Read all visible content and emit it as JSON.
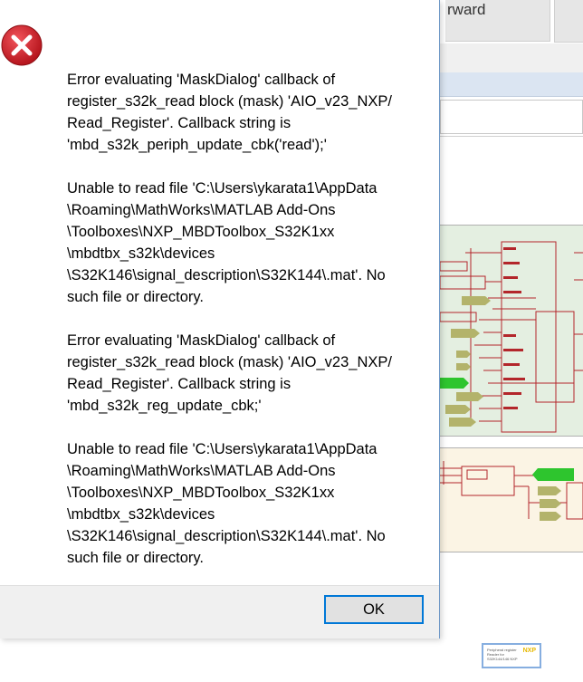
{
  "background_window": {
    "tab_label": "rward",
    "thumbnail_text": "Peripheral register Reader for S32K144/146 NXP"
  },
  "dialog": {
    "icon": "error-icon",
    "messages": {
      "m1": {
        "line1": "Error evaluating 'MaskDialog' callback of",
        "line2": "register_s32k_read block (mask) 'AIO_v23_NXP/",
        "line3": "Read_Register'. Callback string is",
        "line4": "'mbd_s32k_periph_update_cbk('read');'"
      },
      "m2": {
        "line1": "Unable to read file 'C:\\Users\\ykarata1\\AppData",
        "line2": "\\Roaming\\MathWorks\\MATLAB Add-Ons",
        "line3": "\\Toolboxes\\NXP_MBDToolbox_S32K1xx",
        "line4": "\\mbdtbx_s32k\\devices",
        "line5": "\\S32K146\\signal_description\\S32K144\\.mat'. No",
        "line6": "such file or directory."
      },
      "m3": {
        "line1": "Error evaluating 'MaskDialog' callback of",
        "line2": "register_s32k_read block (mask) 'AIO_v23_NXP/",
        "line3": "Read_Register'. Callback string is",
        "line4": "'mbd_s32k_reg_update_cbk;'"
      },
      "m4": {
        "line1": "Unable to read file 'C:\\Users\\ykarata1\\AppData",
        "line2": "\\Roaming\\MathWorks\\MATLAB Add-Ons",
        "line3": "\\Toolboxes\\NXP_MBDToolbox_S32K1xx",
        "line4": "\\mbdtbx_s32k\\devices",
        "line5": "\\S32K146\\signal_description\\S32K144\\.mat'. No",
        "line6": "such file or directory."
      }
    },
    "ok_label": "OK"
  },
  "colors": {
    "error_red": "#d3202a",
    "dialog_border": "#6f98c6",
    "button_focus": "#0078d7",
    "subsystem_green": "#e4efe1",
    "subsystem_yellow": "#fbf4e4",
    "wire_red": "#b3262b",
    "block_green": "#2ec52e",
    "block_olive": "#b3b36b"
  }
}
